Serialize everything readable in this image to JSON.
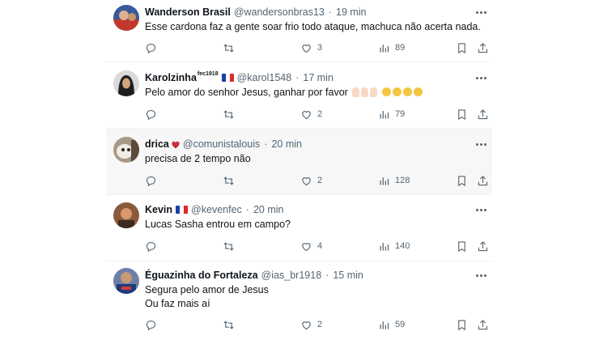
{
  "tweets": [
    {
      "name": "Wanderson Brasil",
      "handle": "@wandersonbras13",
      "time": "19 min",
      "lines": [
        "Esse cardona faz a gente soar frio todo ataque, machuca não acerta nada."
      ],
      "likes": "3",
      "views": "89",
      "replies": "",
      "retweets": "",
      "avatar_color": "#3a5a9a"
    },
    {
      "name": "Karolzinha",
      "name_sup": "fec1918",
      "handle": "@karol1548",
      "time": "17 min",
      "lines": [
        "Pelo amor do senhor Jesus, ganhar por favor"
      ],
      "likes": "2",
      "views": "79",
      "replies": "",
      "retweets": "",
      "avatar_color": "#2b2b2b",
      "badge": "flag-france-icon"
    },
    {
      "name": "drica",
      "handle": "@comunistalouis",
      "time": "20 min",
      "lines": [
        "precisa de 2 tempo não"
      ],
      "likes": "2",
      "views": "128",
      "replies": "",
      "retweets": "",
      "avatar_color": "#8a7462",
      "badge": "anatomical-heart-icon"
    },
    {
      "name": "Kevin",
      "handle": "@kevenfec",
      "time": "20 min",
      "lines": [
        "Lucas Sasha entrou em campo?"
      ],
      "likes": "4",
      "views": "140",
      "replies": "",
      "retweets": "",
      "avatar_color": "#c47b52",
      "badge": "flag-france-icon"
    },
    {
      "name": "Éguazinha do Fortaleza",
      "handle": "@ias_br1918",
      "time": "15 min",
      "lines": [
        "Segura pelo amor de Jesus",
        "Ou faz mais aí"
      ],
      "likes": "2",
      "views": "59",
      "replies": "",
      "retweets": "",
      "avatar_color": "#5e6d8c"
    }
  ],
  "colors": {
    "text": "#0f1419",
    "secondary": "#536471",
    "divider": "#eff3f4",
    "hover_bg": "#f7f7f7"
  }
}
